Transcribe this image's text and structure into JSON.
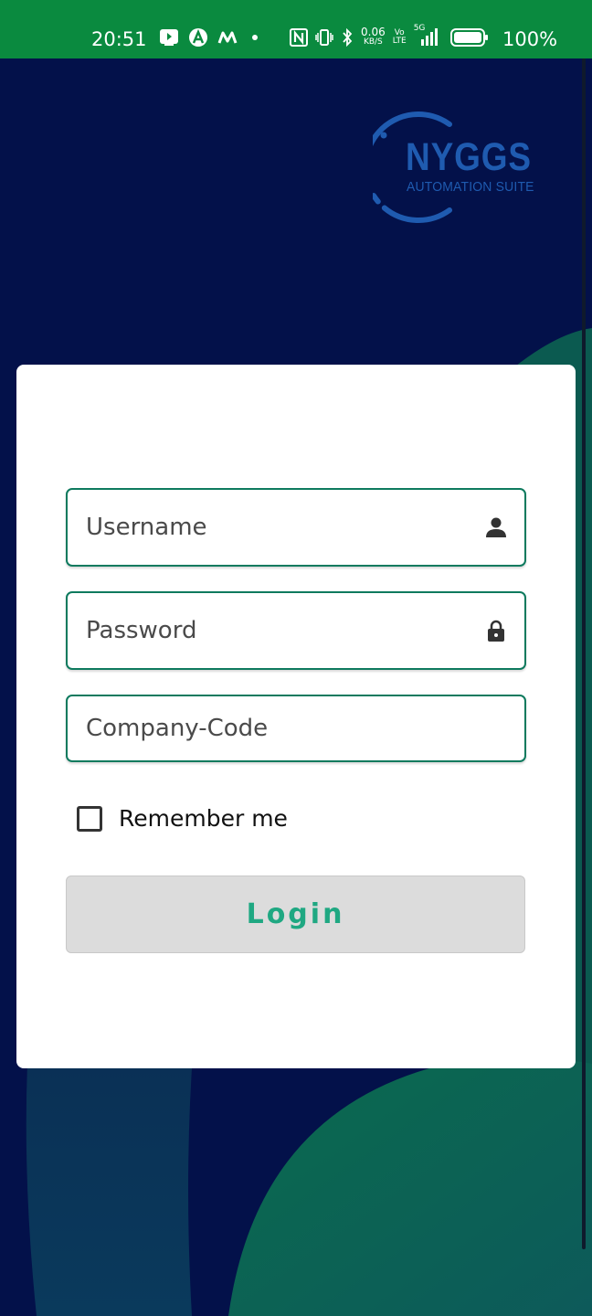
{
  "status_bar": {
    "time": "20:51",
    "net_speed_value": "0.06",
    "net_speed_unit": "KB/S",
    "volte_top": "Vo",
    "volte_bottom": "LTE",
    "signal_label": "5G",
    "battery": "100%",
    "left_icons": [
      "video-app-icon",
      "app-a-icon",
      "app-m-icon",
      "dot-icon"
    ],
    "right_icons": [
      "nfc-icon",
      "vibrate-icon",
      "bluetooth-icon",
      "signal-icon",
      "battery-icon"
    ]
  },
  "logo": {
    "title": "NYGGS",
    "subtitle": "AUTOMATION SUITE"
  },
  "login_form": {
    "username_placeholder": "Username",
    "username_value": "",
    "password_placeholder": "Password",
    "password_value": "",
    "company_code_placeholder": "Company-Code",
    "company_code_value": "",
    "remember_label": "Remember me",
    "remember_checked": false,
    "login_label": "Login"
  },
  "colors": {
    "background": "#03114a",
    "status_bar": "#0a8a3f",
    "accent_green": "#1fa882",
    "field_border": "#0e7a5e",
    "logo_blue": "#1f5bb0",
    "button_bg": "#dcdcdc"
  }
}
